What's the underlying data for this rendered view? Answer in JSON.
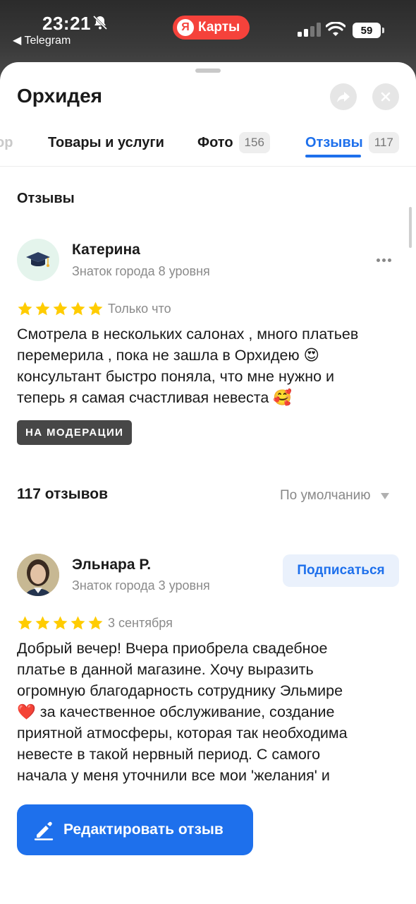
{
  "status_bar": {
    "time": "23:21",
    "back_app": "◀ Telegram",
    "app_pill": "Карты",
    "app_pill_logo": "Я",
    "battery": "59"
  },
  "sheet": {
    "title": "Орхидея",
    "tabs": [
      {
        "label": "ор"
      },
      {
        "label": "Товары и услуги"
      },
      {
        "label": "Фото",
        "count": "156"
      },
      {
        "label": "Отзывы",
        "count": "117"
      }
    ],
    "section_title": "Отзывы",
    "my_review": {
      "author": "Катерина",
      "subtitle": "Знаток города 8 уровня",
      "rating": 5,
      "date": "Только что",
      "text_lines": [
        "Смотрела в нескольких салонах , много платьев",
        "перемерила , пока не зашла в Орхидею 😍",
        "консультант быстро поняла, что мне нужно и",
        "теперь я самая счастливая невеста 🥰"
      ],
      "status_badge": "НА МОДЕРАЦИИ"
    },
    "reviews_count": "117 отзывов",
    "sort_label": "По умолчанию",
    "review": {
      "author": "Эльнара Р.",
      "subtitle": "Знаток города 3 уровня",
      "subscribe_label": "Подписаться",
      "rating": 5,
      "date": "3 сентября",
      "text_lines": [
        "Добрый вечер! Вчера приобрела свадебное",
        "платье в данной магазине. Хочу выразить",
        "огромную благодарность сотруднику Эльмире",
        "❤️ за качественное обслуживание, создание",
        "приятной атмосферы, которая так необходима",
        "невесте в такой нервный период. С самого",
        "начала у меня уточнили все мои 'желания' и"
      ]
    },
    "edit_button": "Редактировать отзыв",
    "colors": {
      "accent": "#1e70ec",
      "star": "#ffcc00",
      "pill": "#f5423b"
    }
  }
}
